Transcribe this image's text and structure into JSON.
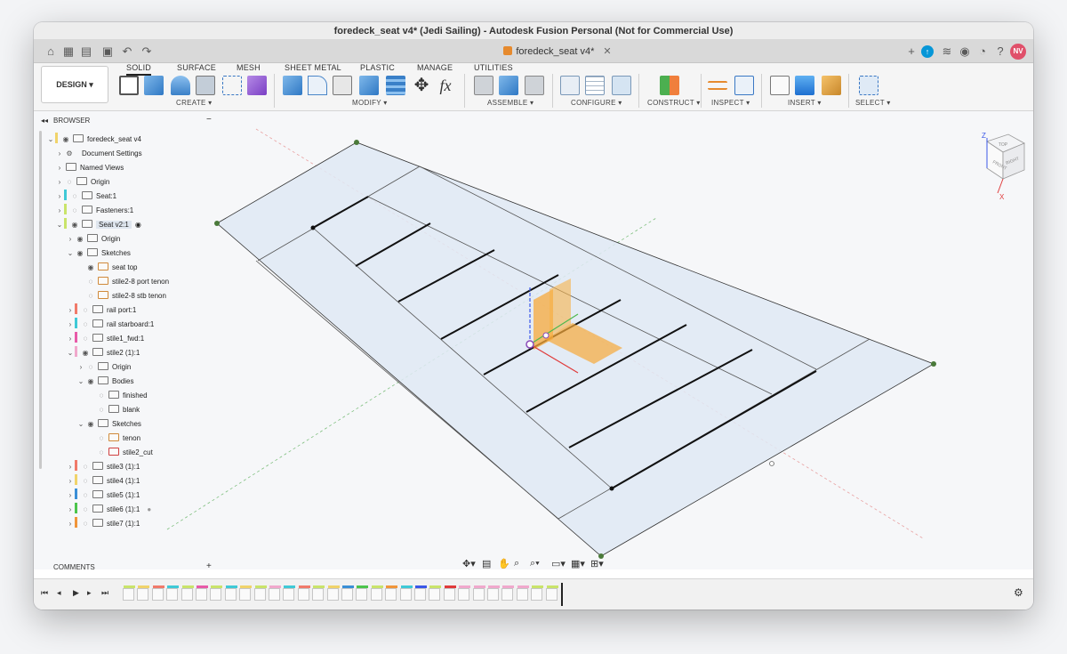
{
  "window": {
    "title": "foredeck_seat v4* (Jedi Sailing) - Autodesk Fusion Personal (Not for Commercial Use)"
  },
  "tabbar": {
    "doc_tab_label": "foredeck_seat v4*",
    "user_initials": "NV"
  },
  "ribbon": {
    "workspace": "DESIGN",
    "tabs": [
      "SOLID",
      "SURFACE",
      "MESH",
      "SHEET METAL",
      "PLASTIC",
      "MANAGE",
      "UTILITIES"
    ],
    "groups": [
      "CREATE",
      "MODIFY",
      "ASSEMBLE",
      "CONFIGURE",
      "CONSTRUCT",
      "INSPECT",
      "INSERT",
      "SELECT"
    ]
  },
  "browser": {
    "title": "BROWSER",
    "items": [
      {
        "label": "foredeck_seat v4"
      },
      {
        "label": "Document Settings"
      },
      {
        "label": "Named Views"
      },
      {
        "label": "Origin"
      },
      {
        "label": "Seat:1"
      },
      {
        "label": "Fasteners:1"
      },
      {
        "label": "Seat v2:1"
      },
      {
        "label": "Origin"
      },
      {
        "label": "Sketches"
      },
      {
        "label": "seat top"
      },
      {
        "label": "stile2-8 port tenon"
      },
      {
        "label": "stile2-8 stb tenon"
      },
      {
        "label": "rail port:1"
      },
      {
        "label": "rail starboard:1"
      },
      {
        "label": "stile1_fwd:1"
      },
      {
        "label": "stile2 (1):1"
      },
      {
        "label": "Origin"
      },
      {
        "label": "Bodies"
      },
      {
        "label": "finished"
      },
      {
        "label": "blank"
      },
      {
        "label": "Sketches"
      },
      {
        "label": "tenon"
      },
      {
        "label": "stile2_cut"
      },
      {
        "label": "stile3 (1):1"
      },
      {
        "label": "stile4 (1):1"
      },
      {
        "label": "stile5 (1):1"
      },
      {
        "label": "stile6 (1):1"
      },
      {
        "label": "stile7 (1):1"
      }
    ]
  },
  "comments": {
    "title": "COMMENTS"
  },
  "viewcube": {
    "top": "TOP",
    "front": "FRONT",
    "right": "RIGHT",
    "axis_z": "Z",
    "axis_x": "X"
  },
  "colors": {
    "accent": "#0696d7",
    "sketch_fill": "#dfe9f5",
    "plane_orange": "#f7a93b",
    "node_green": "#4a7a3a",
    "axis_red": "#e03a3a",
    "axis_green": "#4db84d",
    "axis_blue": "#3a57e8"
  }
}
